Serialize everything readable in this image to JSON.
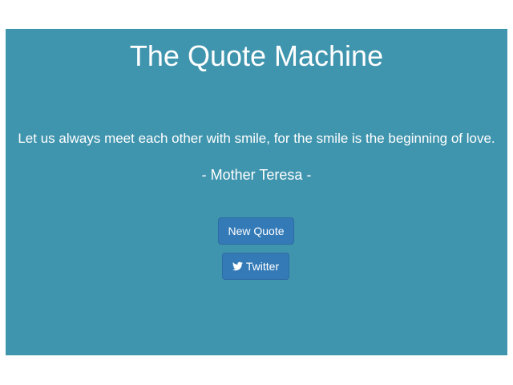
{
  "app": {
    "title": "The Quote Machine"
  },
  "quote": {
    "text": "Let us always meet each other with smile, for the smile is the beginning of love.",
    "author": "- Mother Teresa -"
  },
  "buttons": {
    "new_quote_label": "New Quote",
    "twitter_label": "Twitter",
    "twitter_icon": "twitter-icon"
  },
  "colors": {
    "panel_background": "#4095ae",
    "button_background": "#337ab7",
    "text": "#ffffff"
  }
}
